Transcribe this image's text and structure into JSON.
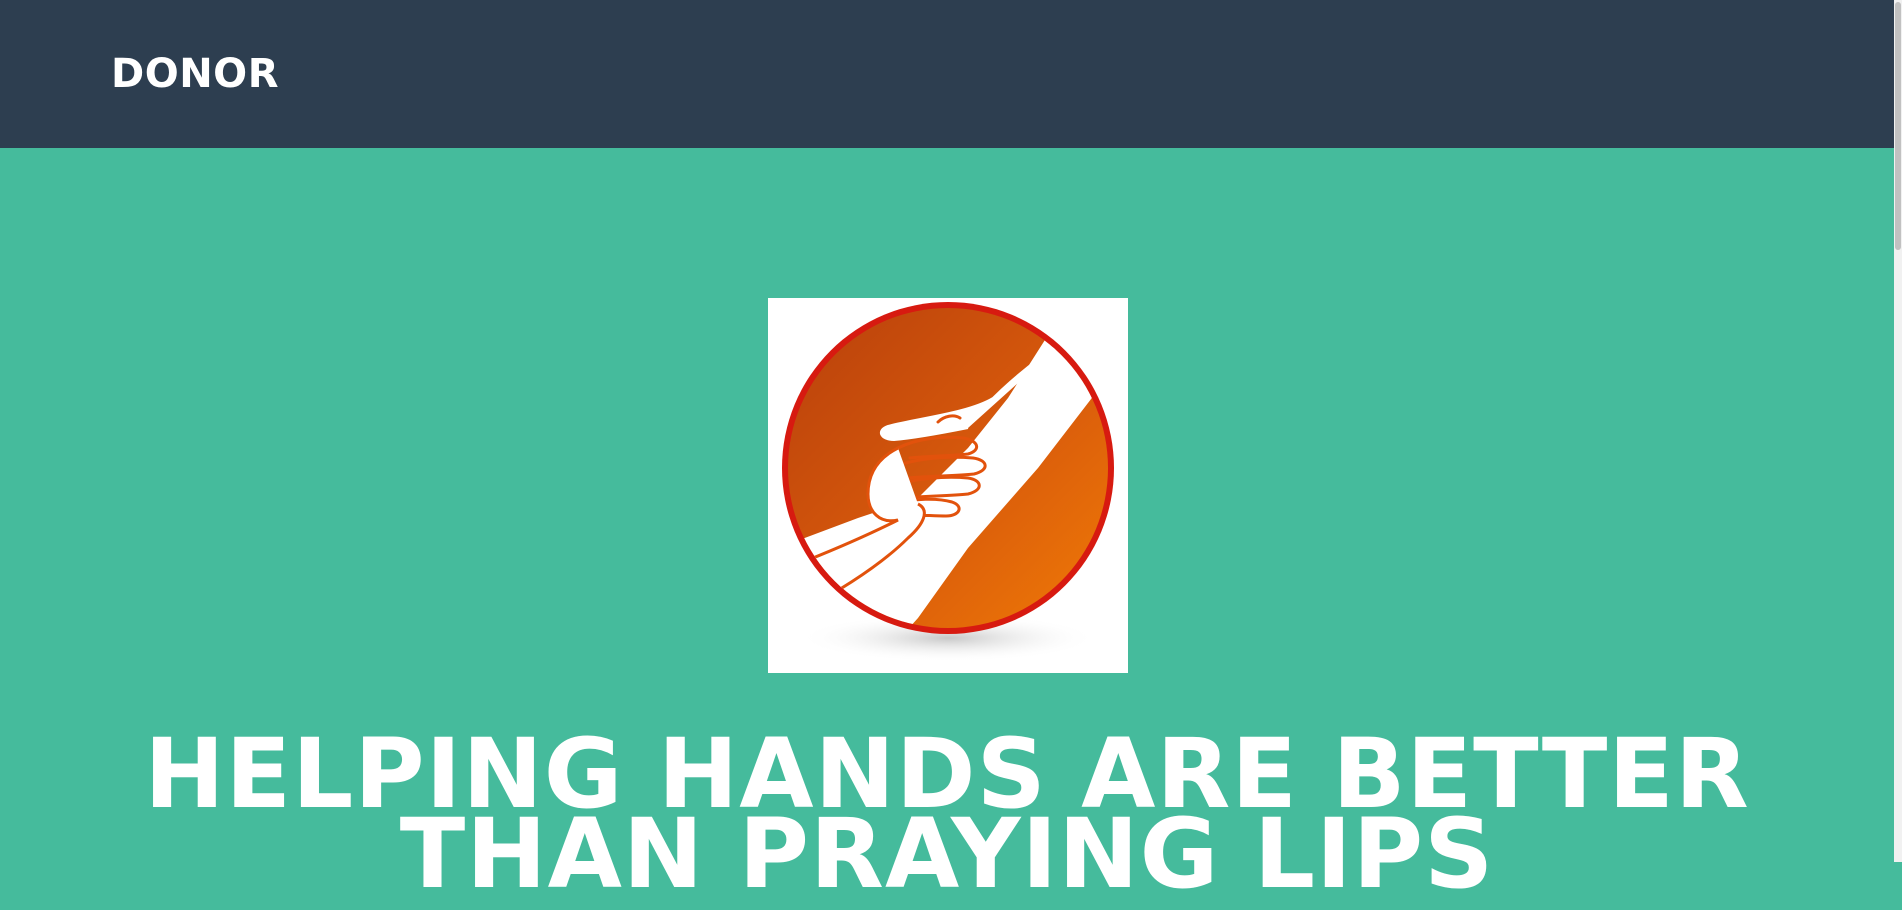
{
  "navbar": {
    "brand": "DONOR",
    "background_color": "#2d3e50"
  },
  "hero": {
    "background_color": "#45bb9c",
    "logo_icon": "helping-hands-logo-icon",
    "headline_line1": "HELPING HANDS ARE BETTER",
    "headline_line2": "THAN PRAYING LIPS"
  },
  "colors": {
    "logo_orange": "#e86a10",
    "logo_red": "#d71a10",
    "text": "#ffffff"
  }
}
